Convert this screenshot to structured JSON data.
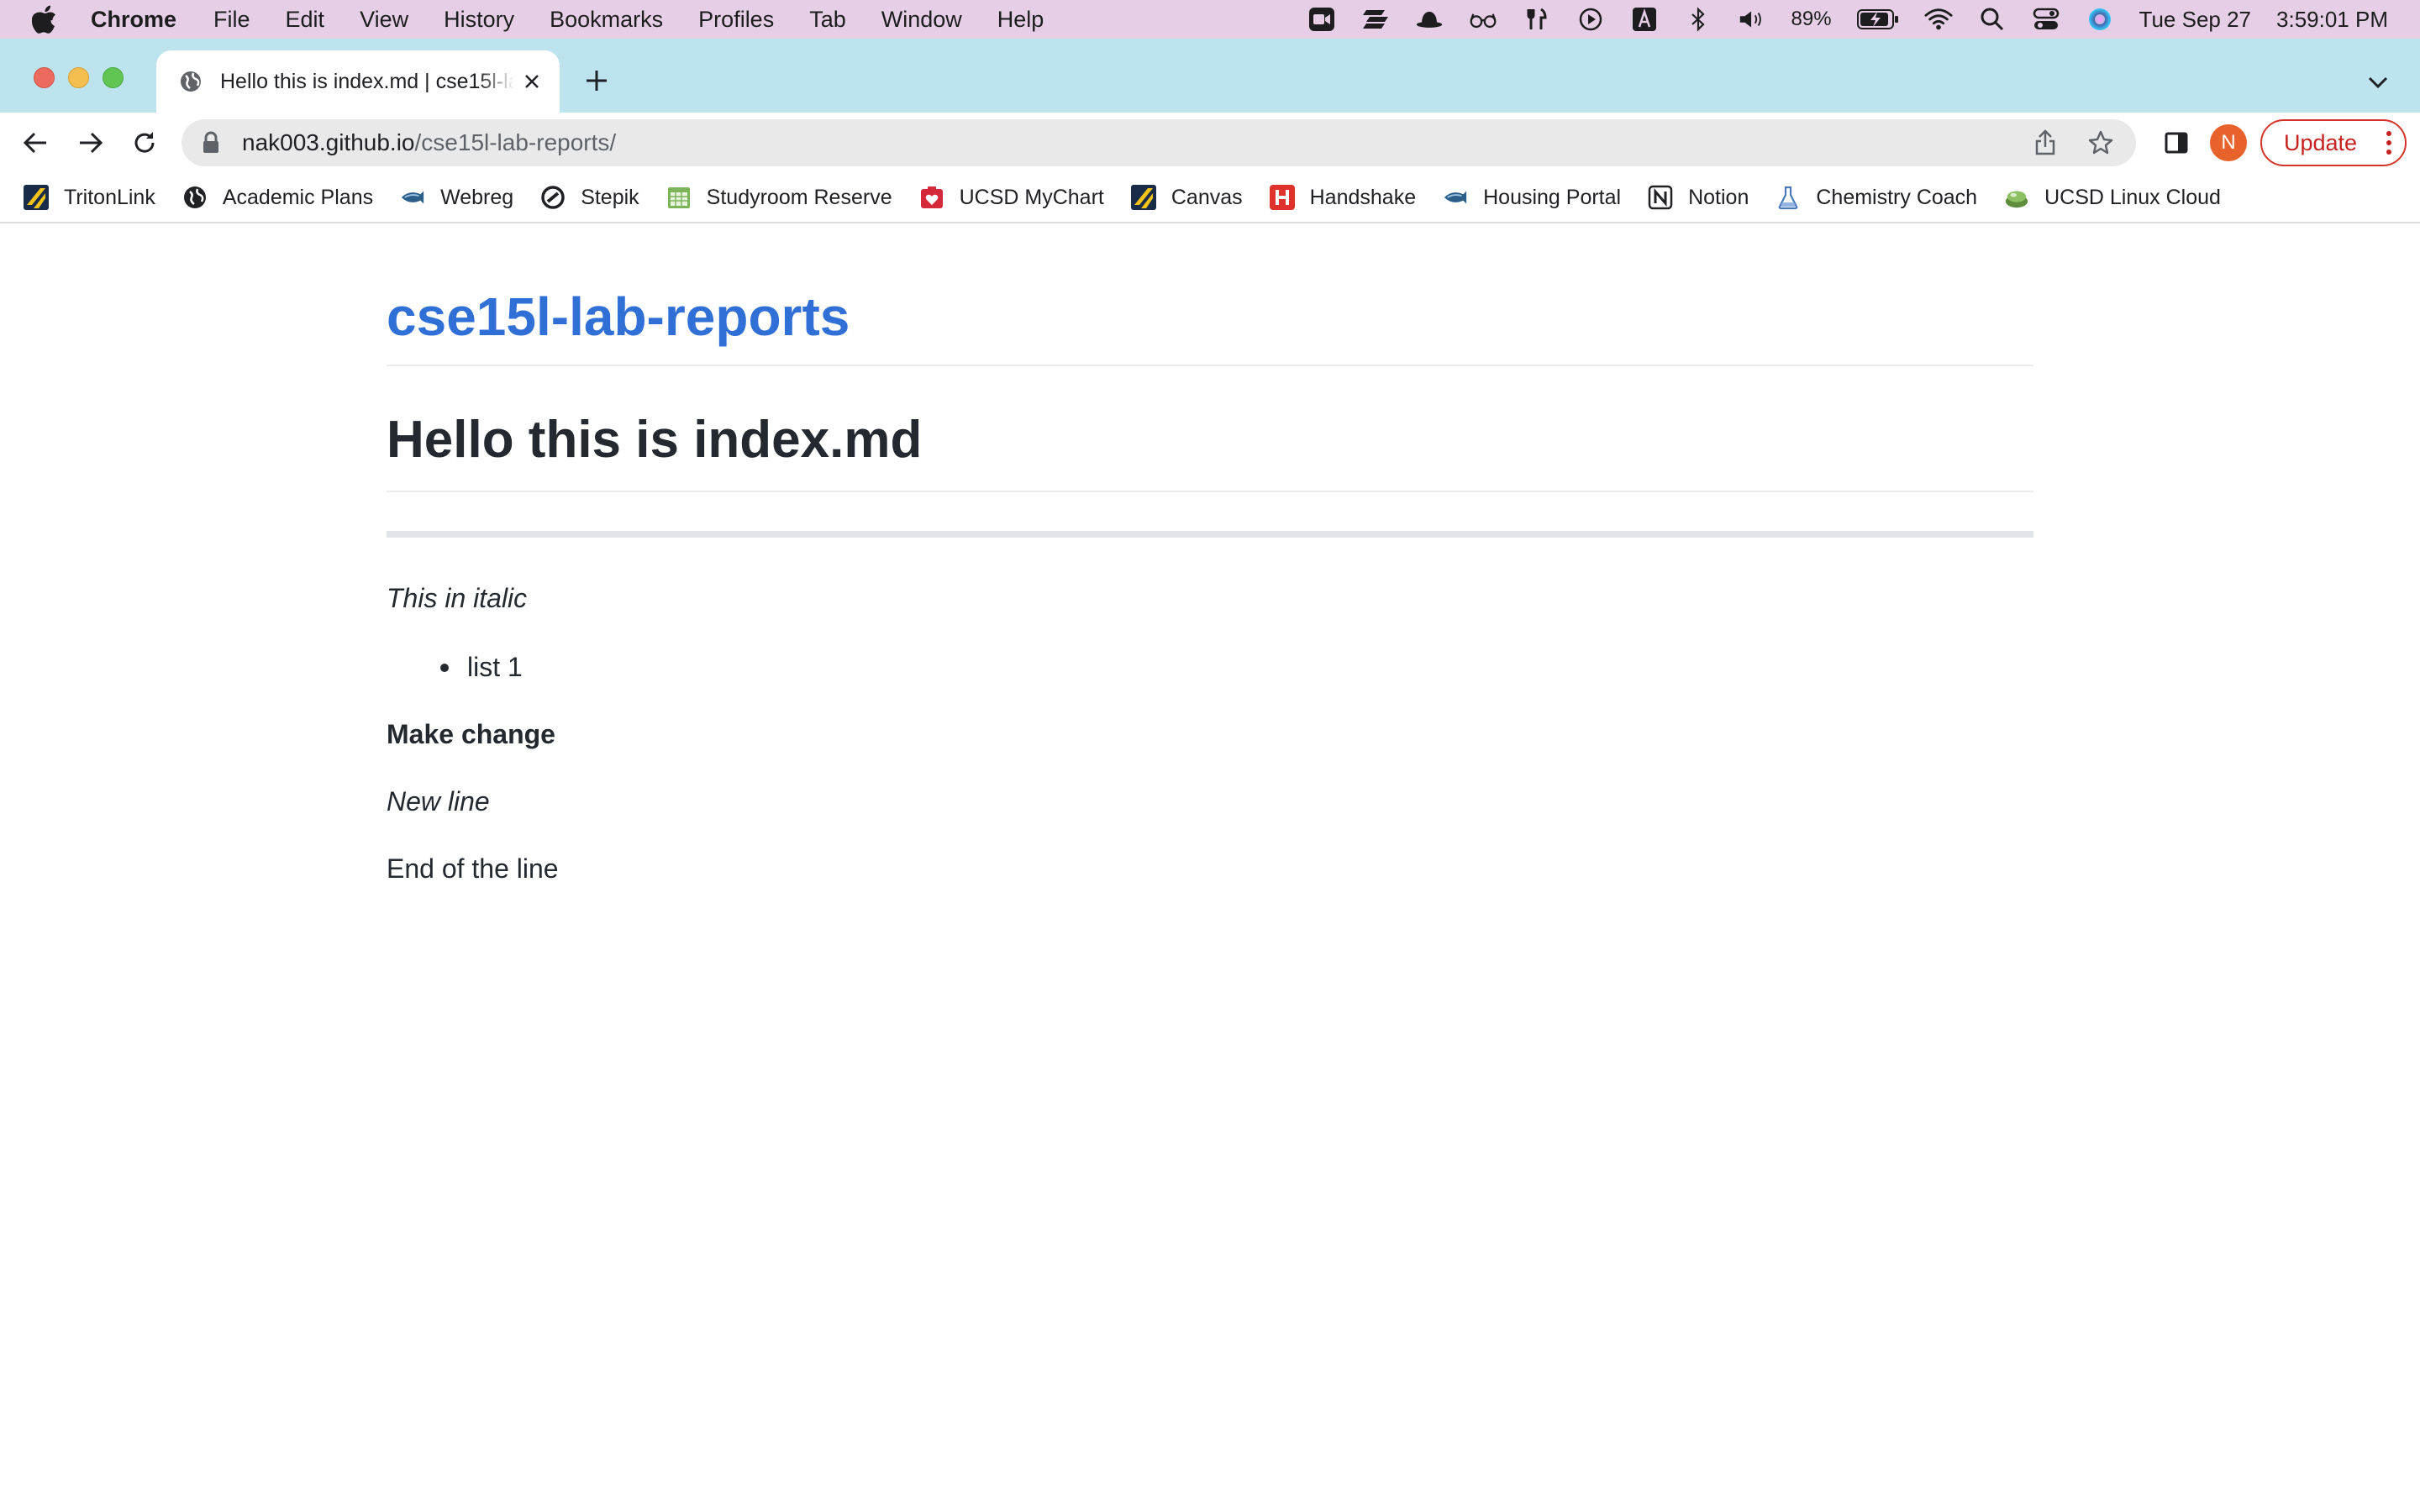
{
  "menubar": {
    "app_name": "Chrome",
    "items": [
      "File",
      "Edit",
      "View",
      "History",
      "Bookmarks",
      "Profiles",
      "Tab",
      "Window",
      "Help"
    ],
    "battery_percent": "89%",
    "date": "Tue Sep 27",
    "time": "3:59:01 PM"
  },
  "tabs": [
    {
      "title": "Hello this is index.md | cse15l-lab-reports"
    }
  ],
  "address_bar": {
    "host": "nak003.github.io",
    "path": "/cse15l-lab-reports/"
  },
  "profile": {
    "initial": "N"
  },
  "update_button": {
    "label": "Update"
  },
  "bookmarks": [
    {
      "label": "TritonLink",
      "icon": "tritonlink-icon"
    },
    {
      "label": "Academic Plans",
      "icon": "globe-icon"
    },
    {
      "label": "Webreg",
      "icon": "triton-fish-icon"
    },
    {
      "label": "Stepik",
      "icon": "stepik-icon"
    },
    {
      "label": "Studyroom Reserve",
      "icon": "calendar-icon"
    },
    {
      "label": "UCSD MyChart",
      "icon": "mychart-icon"
    },
    {
      "label": "Canvas",
      "icon": "canvas-icon"
    },
    {
      "label": "Handshake",
      "icon": "handshake-icon"
    },
    {
      "label": "Housing Portal",
      "icon": "triton-fish-icon"
    },
    {
      "label": "Notion",
      "icon": "notion-icon"
    },
    {
      "label": "Chemistry Coach",
      "icon": "flask-icon"
    },
    {
      "label": "UCSD Linux Cloud",
      "icon": "cloud-icon"
    }
  ],
  "page": {
    "site_title": "cse15l-lab-reports",
    "heading": "Hello this is index.md",
    "italic_text": "This in italic",
    "list_items": [
      "list 1"
    ],
    "bold_text": "Make change",
    "italic_line": "New line",
    "last_line": "End of the line"
  },
  "colors": {
    "menubar_bg": "#e6cfe6",
    "tabstrip_bg": "#bde4ee",
    "site_title": "#2f6fd6",
    "update_border": "#d3342a",
    "avatar_bg": "#e8622c"
  }
}
